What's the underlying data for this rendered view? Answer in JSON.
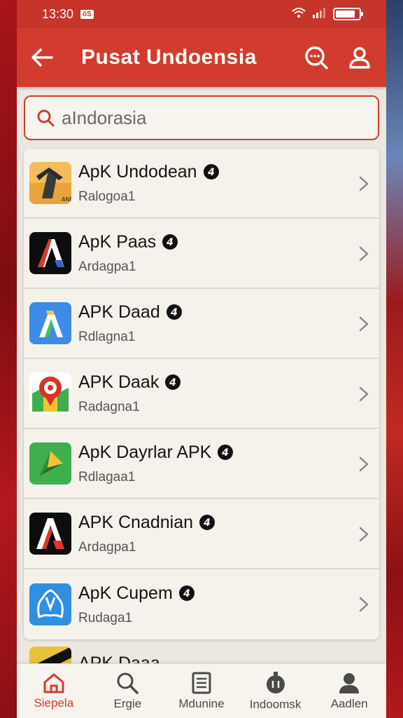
{
  "status_bar": {
    "time": "13:30",
    "badge": "öS"
  },
  "app_bar": {
    "title": "Pusat Undoensia"
  },
  "search": {
    "value": "aIndorasia",
    "placeholder": ""
  },
  "apps": [
    {
      "title": "ApK Undodean",
      "subtitle": "Ralogoa1",
      "icon": "tower-app-icon"
    },
    {
      "title": "ApK Paas",
      "subtitle": "Ardagpa1",
      "icon": "letter-a-dark-app-icon"
    },
    {
      "title": "APK Daad",
      "subtitle": "Rdlagna1",
      "icon": "letter-a-blue-app-icon"
    },
    {
      "title": "APK Daak",
      "subtitle": "Radagna1",
      "icon": "map-pin-app-icon"
    },
    {
      "title": "ApK Dayrlar APK",
      "subtitle": "Rdlagaa1",
      "icon": "play-triangle-app-icon"
    },
    {
      "title": "APK Cnadnian",
      "subtitle": "Ardagpa1",
      "icon": "letter-a-red-app-icon"
    },
    {
      "title": "ApK Cupem",
      "subtitle": "Rudaga1",
      "icon": "blue-outline-app-icon"
    }
  ],
  "peek_item": {
    "title": "APK Daaa"
  },
  "bottom_nav": [
    {
      "label": "Siepela",
      "icon": "home-icon",
      "active": true
    },
    {
      "label": "Ergie",
      "icon": "search-icon",
      "active": false
    },
    {
      "label": "Mdunine",
      "icon": "document-icon",
      "active": false
    },
    {
      "label": "Indoomsk",
      "icon": "timer-icon",
      "active": false
    },
    {
      "label": "Aadlen",
      "icon": "profile-icon",
      "active": false
    }
  ],
  "colors": {
    "accent": "#d13c2e",
    "status": "#c6342a",
    "background": "#ece8e1"
  }
}
